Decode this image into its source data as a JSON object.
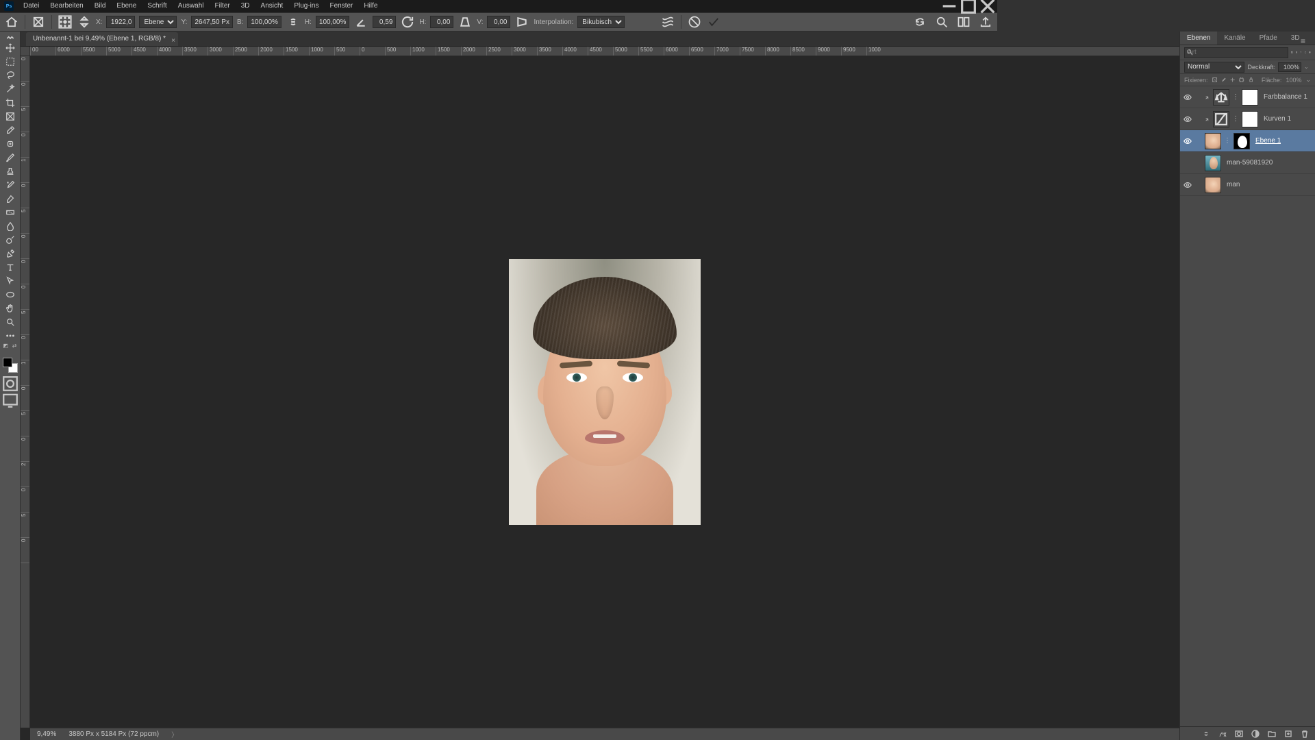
{
  "app": {
    "badge": "Ps"
  },
  "menu": [
    "Datei",
    "Bearbeiten",
    "Bild",
    "Ebene",
    "Schrift",
    "Auswahl",
    "Filter",
    "3D",
    "Ansicht",
    "Plug-ins",
    "Fenster",
    "Hilfe"
  ],
  "optbar": {
    "x_lbl": "X:",
    "x": "1922,0",
    "unit_options": [
      "Ebene"
    ],
    "unit": "Ebene",
    "y_lbl": "Y:",
    "y": "2647,50 Px",
    "w_lbl": "B:",
    "w": "100,00%",
    "h_lbl": "H:",
    "h": "100,00%",
    "ang_lbl": "∠",
    "ang": "0,59",
    "skewh_lbl": "H:",
    "skewh": "0,00",
    "skewv_lbl": "V:",
    "skewv": "0,00",
    "interp_lbl": "Interpolation:",
    "interp_options": [
      "Bikubisch"
    ],
    "interp": "Bikubisch"
  },
  "doc": {
    "tab_title": "Unbenannt-1 bei 9,49% (Ebene 1, RGB/8) *",
    "zoom": "9,49%",
    "dims": "3880 Px x 5184 Px (72 ppcm)"
  },
  "ruler_h": [
    "00",
    "6000",
    "5500",
    "5000",
    "4500",
    "4000",
    "3500",
    "3000",
    "2500",
    "2000",
    "1500",
    "1000",
    "500",
    "0",
    "500",
    "1000",
    "1500",
    "2000",
    "2500",
    "3000",
    "3500",
    "4000",
    "4500",
    "5000",
    "5500",
    "6000",
    "6500",
    "7000",
    "7500",
    "8000",
    "8500",
    "9000",
    "9500",
    "1000"
  ],
  "ruler_v": [
    "0",
    "0",
    "5",
    "0",
    "1",
    "0",
    "5",
    "0",
    "0",
    "0",
    "5",
    "0",
    "1",
    "0",
    "5",
    "0",
    "2",
    "0",
    "5",
    "0"
  ],
  "panels": {
    "tabs": [
      "Ebenen",
      "Kanäle",
      "Pfade",
      "3D"
    ],
    "search_placeholder": "Art",
    "blend_options": [
      "Normal"
    ],
    "blend": "Normal",
    "opacity_lbl": "Deckkraft:",
    "opacity": "100%",
    "lock_lbl": "Fixieren:",
    "fill_lbl": "Fläche:",
    "fill": "100%"
  },
  "layers": [
    {
      "visible": true,
      "clip": true,
      "adj": "balance",
      "mask": "white",
      "name": "Farbbalance 1",
      "selected": false
    },
    {
      "visible": true,
      "clip": true,
      "adj": "curves",
      "mask": "white",
      "name": "Kurven 1",
      "selected": false
    },
    {
      "visible": true,
      "clip": false,
      "thumb": "face",
      "mask": "face",
      "name": "Ebene 1",
      "selected": true,
      "smart": true
    },
    {
      "visible": false,
      "clip": false,
      "thumb": "water",
      "name": "man-59081920",
      "selected": false
    },
    {
      "visible": true,
      "clip": false,
      "thumb": "face",
      "name": "man",
      "selected": false
    }
  ]
}
